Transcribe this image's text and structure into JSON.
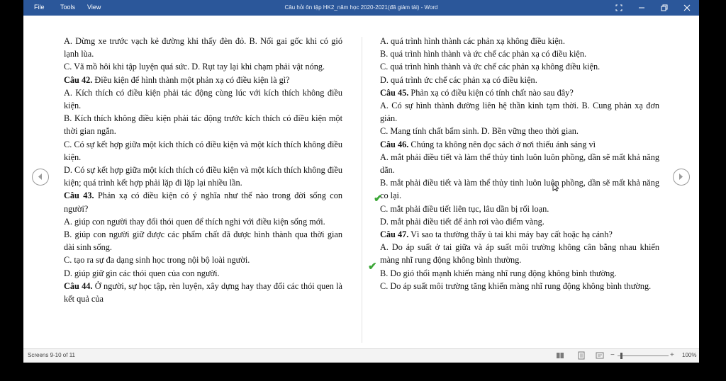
{
  "titlebar": {
    "menus": [
      "File",
      "Tools",
      "View"
    ],
    "title": "Câu hỏi ôn tập HK2_năm học 2020-2021(đã giảm tải) - Word"
  },
  "left_column": [
    "A. Dừng xe trước vạch kẻ đường khi thấy đèn đỏ.          B. Nổi gai gốc khi có gió lạnh lùa.",
    "C. Vã mồ hôi khi tập luyện quá sức.                              D. Rụt tay lại khi chạm phải vật nóng.",
    {
      "label": "Câu 42.",
      "text": " Điều kiện để hình thành một phản xạ có điều kiện là gì?"
    },
    "A. Kích thích có điều kiện phải tác động cùng lúc với kích thích không điều kiện.",
    "B. Kích thích không điều kiện phải tác động trước kích thích có điều kiện một thời gian ngắn.",
    "C. Có sự kết hợp giữa một kích thích có điều kiện và một kích thích không điều kiện.",
    "D. Có sự kết hợp giữa một kích thích có điều kiện và một kích thích không điều kiện; quá trình kết hợp phải lặp đi lặp lại nhiều lần.",
    {
      "label": "Câu 43.",
      "text": " Phản xạ có điều kiện có ý nghĩa như thế nào trong đời sống con người?"
    },
    "A. giúp con người thay đổi thói quen để thích nghi với điều kiện sống mới.",
    "B. giúp con người giữ được các phẩm chất đã được hình thành qua thời gian dài sinh sống.",
    "C. tạo ra sự đa dạng sinh học trong nội bộ loài người.",
    "D. giúp giữ gìn các thói quen của con người.",
    {
      "label": "Câu 44.",
      "text": " Ở người, sự học tập, rèn luyện, xây dựng hay thay đổi các thói quen là kết quả của"
    }
  ],
  "right_column": [
    "A. quá trình hình thành các phản xạ không điều kiện.",
    "B. quá trình hình thành và ức chế các phản xạ có điều kiện.",
    "C. quá trình hình thành và ức chế các phản xạ không điều kiện.",
    "D. quá trình ức chế các phản xạ có điều kiện.",
    {
      "label": "Câu 45.",
      "text": " Phản xạ có điều kiện có tính chất nào sau đây?"
    },
    "A. Có sự hình thành đường liên hệ thần kinh tạm thời.          B. Cung phản xạ đơn giản.",
    "C. Mang tính chất bẩm sinh.                                                D. Bền vững theo thời gian.",
    {
      "label": "Câu 46.",
      "text": " Chúng ta không nên đọc sách ở nơi thiếu ánh sáng vì"
    },
    "A. mắt phải điều tiết và làm thể thủy tinh luôn luôn phồng, dần sẽ mất khả năng dãn.",
    "B. mắt phải điều tiết và làm thể thủy tinh luôn luôn phồng, dần sẽ mất khả năng co lại.",
    "C. mắt phải điều tiết liên tục, lâu dần bị rối loạn.",
    "D. mắt phải điều tiết để ảnh rơi vào điểm vàng.",
    {
      "label": "Câu 47.",
      "text": " Vì sao ta thường thấy ù tai khi máy bay cất hoặc hạ cánh?"
    },
    "A. Do áp suất ở tai giữa và áp suất môi trường không cân bằng nhau khiến màng nhĩ rung động không bình thường.",
    "B. Do gió thổi mạnh khiến màng nhĩ rung động không bình thường.",
    "C. Do áp suất môi trường tăng khiến màng nhĩ rung động không bình thường."
  ],
  "status": {
    "screens": "Screens 9-10 of 11",
    "zoom": "100%",
    "zoom_minus": "−",
    "zoom_plus": "+"
  }
}
